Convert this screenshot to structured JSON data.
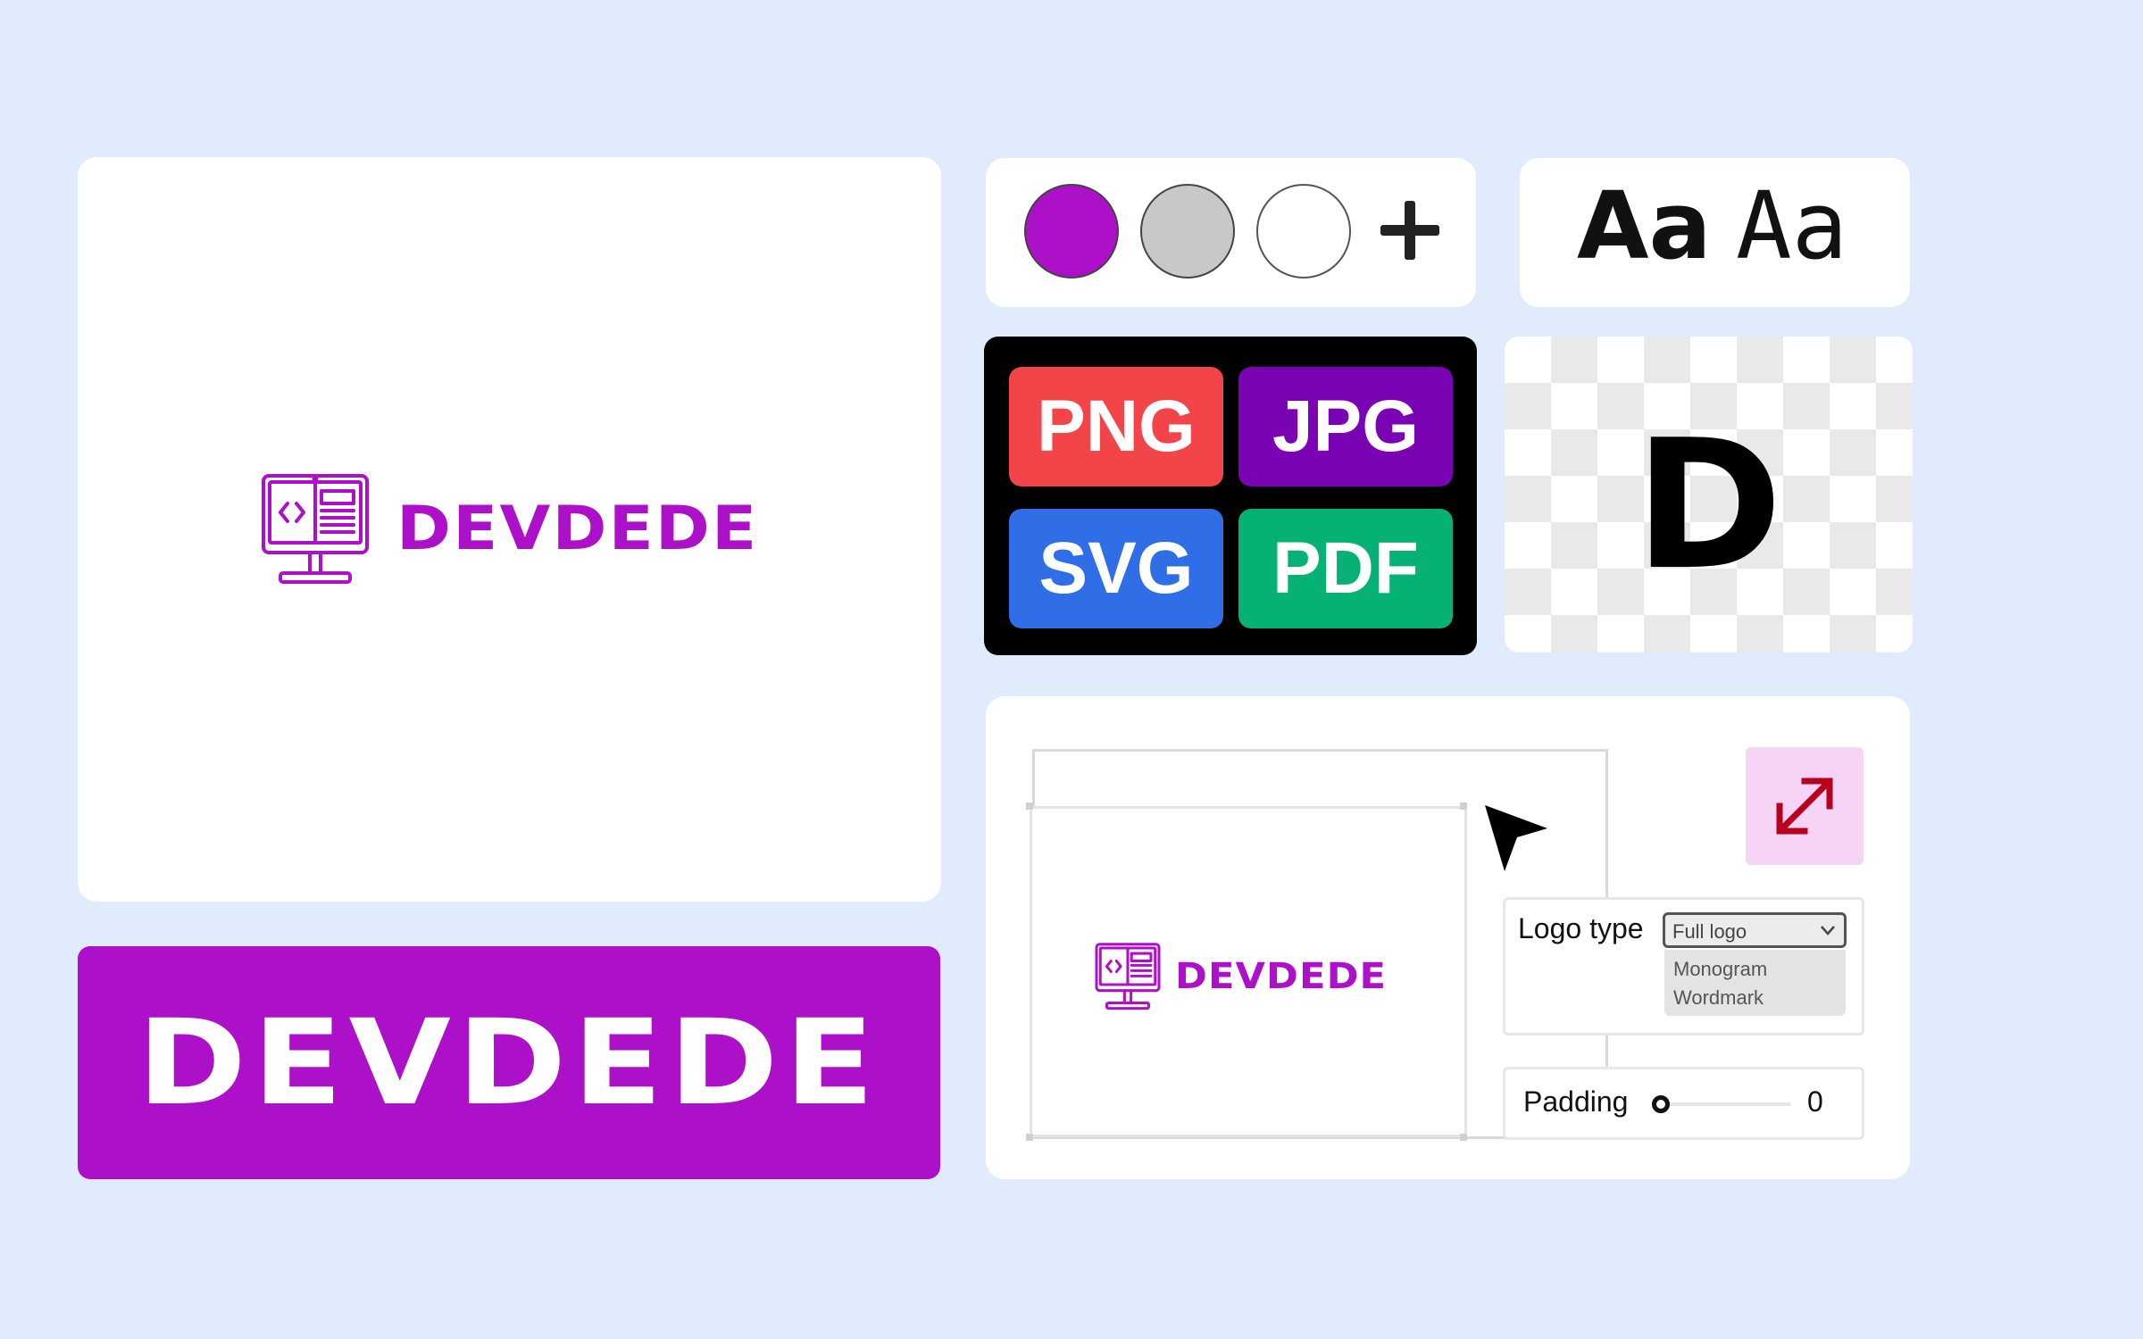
{
  "brand": {
    "name": "DEVDEDE",
    "color": "#ad10c9"
  },
  "icons": {
    "logo_mark": "monitor-code-icon",
    "add": "plus-icon",
    "resize": "resize-arrows-icon",
    "cursor": "mouse-pointer-icon",
    "dropdown": "chevron-down-icon"
  },
  "colors": {
    "swatches": [
      {
        "name": "purple",
        "hex": "#ad10c9"
      },
      {
        "name": "gray",
        "hex": "#c8c8c8"
      },
      {
        "name": "white",
        "hex": "#ffffff"
      }
    ]
  },
  "fonts": {
    "sample_1": "Aa",
    "sample_2": "Aa"
  },
  "formats": {
    "png": "PNG",
    "jpg": "JPG",
    "svg": "SVG",
    "pdf": "PDF",
    "colors": {
      "png": "#f24449",
      "jpg": "#7a03b3",
      "svg": "#2f6ee6",
      "pdf": "#05b173"
    }
  },
  "monogram": {
    "letter": "D"
  },
  "banner": {
    "text": "DEVDEDE"
  },
  "editor": {
    "logo_type": {
      "label": "Logo type",
      "selected": "Full logo",
      "options": [
        "Monogram",
        "Wordmark"
      ]
    },
    "padding": {
      "label": "Padding",
      "value": "0"
    }
  }
}
